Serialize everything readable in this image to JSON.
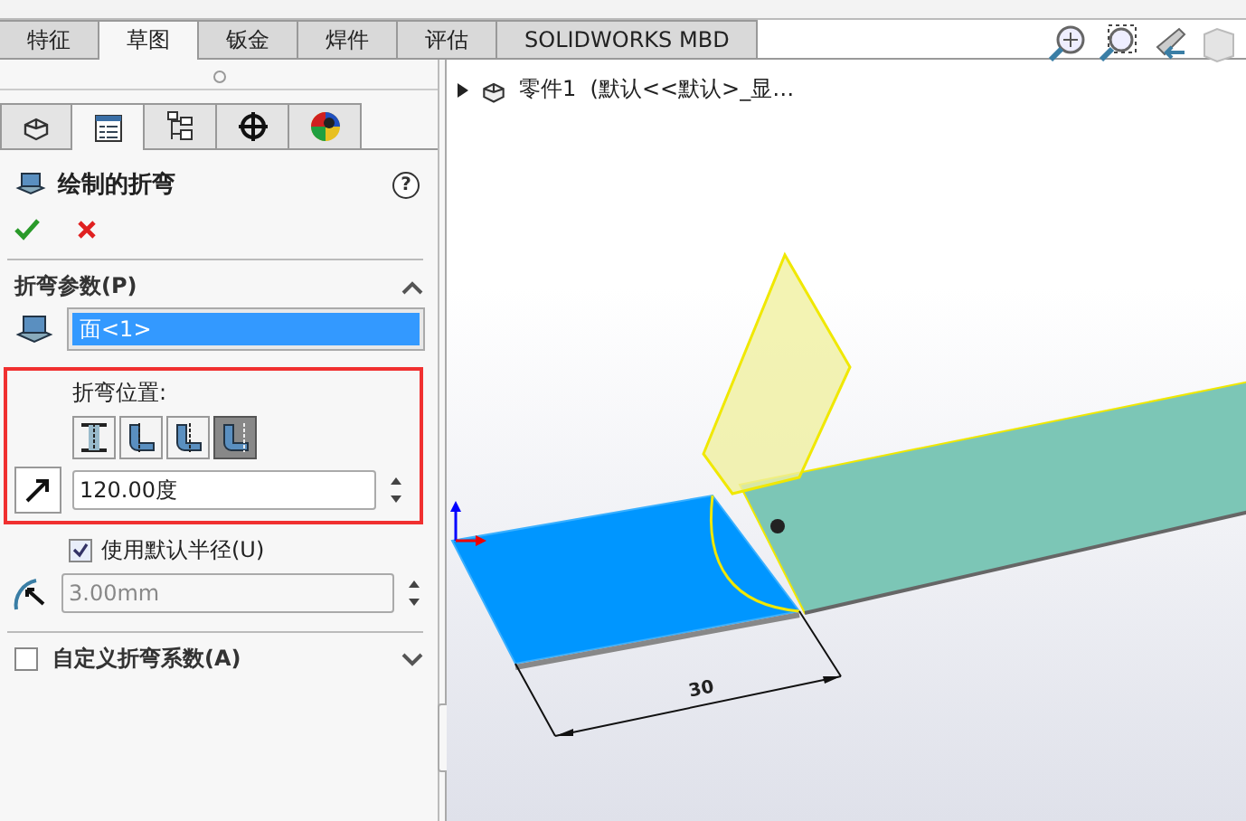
{
  "command_tabs": [
    {
      "label": "特征",
      "selected": false
    },
    {
      "label": "草图",
      "selected": true
    },
    {
      "label": "钣金",
      "selected": false
    },
    {
      "label": "焊件",
      "selected": false
    },
    {
      "label": "评估",
      "selected": false
    },
    {
      "label": "SOLIDWORKS MBD",
      "selected": false
    }
  ],
  "panel_tabs": [
    {
      "kind": "part",
      "selected": false
    },
    {
      "kind": "property",
      "selected": true
    },
    {
      "kind": "config",
      "selected": false
    },
    {
      "kind": "target",
      "selected": false
    },
    {
      "kind": "appearance",
      "selected": false
    }
  ],
  "property_manager": {
    "title": "绘制的折弯",
    "help": "?",
    "bend_parameters": {
      "heading": "折弯参数(P)",
      "expanded": true,
      "face_value": "面<1>",
      "position_label": "折弯位置:",
      "positions": [
        {
          "kind": "centerline",
          "selected": false
        },
        {
          "kind": "material-inside",
          "selected": false
        },
        {
          "kind": "material-outside",
          "selected": false
        },
        {
          "kind": "bend-outside",
          "selected": true
        }
      ],
      "angle_value": "120.00度",
      "default_radius": {
        "label": "使用默认半径(U)",
        "checked": true
      },
      "radius_value": "3.00mm",
      "radius_disabled": true
    },
    "custom_allowance": {
      "label": "自定义折弯系数(A)",
      "checked": false,
      "expanded": false
    }
  },
  "tree": {
    "item": "零件1  (默认<<默认>_显…"
  },
  "viewport": {
    "dimension": "30"
  }
}
